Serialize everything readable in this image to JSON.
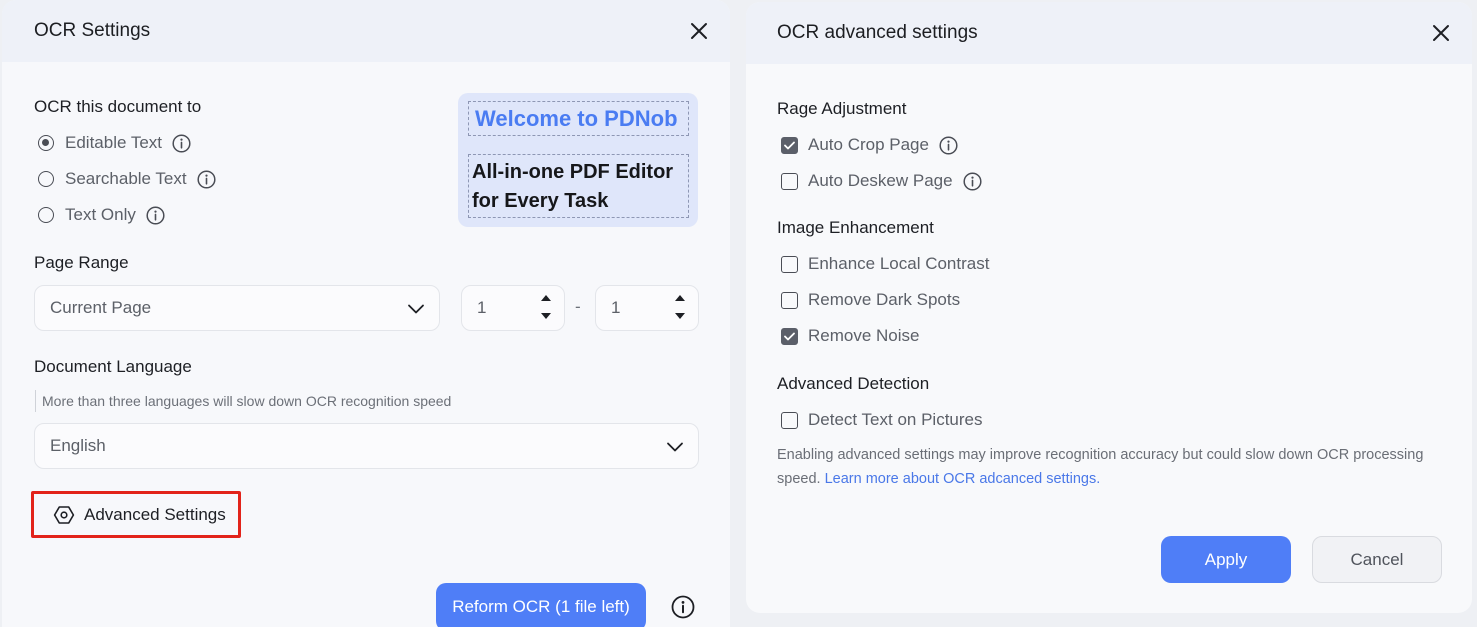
{
  "ocr_settings": {
    "title": "OCR Settings",
    "ocr_to": {
      "label": "OCR this document to",
      "options": [
        {
          "label": "Editable Text",
          "selected": true
        },
        {
          "label": "Searchable Text",
          "selected": false
        },
        {
          "label": "Text Only",
          "selected": false
        }
      ]
    },
    "preview": {
      "line1": "Welcome to PDNob",
      "line2a": "All-in-one PDF Editor",
      "line2b": "for Every Task"
    },
    "page_range": {
      "label": "Page Range",
      "selected": "Current Page",
      "from": "1",
      "separator": "-",
      "to": "1"
    },
    "language": {
      "label": "Document Language",
      "hint": "More than three languages will slow down OCR recognition speed",
      "selected": "English"
    },
    "advanced_button": "Advanced Settings",
    "run_button": "Reform OCR (1 file left)"
  },
  "advanced_settings": {
    "title": "OCR advanced settings",
    "groups": [
      {
        "label": "Rage Adjustment",
        "items": [
          {
            "label": "Auto Crop Page",
            "checked": true,
            "info": true
          },
          {
            "label": "Auto Deskew Page",
            "checked": false,
            "info": true
          }
        ]
      },
      {
        "label": "Image Enhancement",
        "items": [
          {
            "label": "Enhance Local Contrast",
            "checked": false
          },
          {
            "label": "Remove Dark Spots",
            "checked": false
          },
          {
            "label": "Remove Noise",
            "checked": true
          }
        ]
      },
      {
        "label": "Advanced Detection",
        "items": [
          {
            "label": "Detect Text on Pictures",
            "checked": false
          }
        ]
      }
    ],
    "note": "Enabling advanced settings may improve recognition accuracy but could slow down OCR processing speed.",
    "note_link": "Learn more about OCR adcanced settings.",
    "apply_button": "Apply",
    "cancel_button": "Cancel"
  },
  "colors": {
    "accent": "#4f7ef7",
    "highlight_border": "#e2231a",
    "preview_bg": "#dfe6fa"
  }
}
